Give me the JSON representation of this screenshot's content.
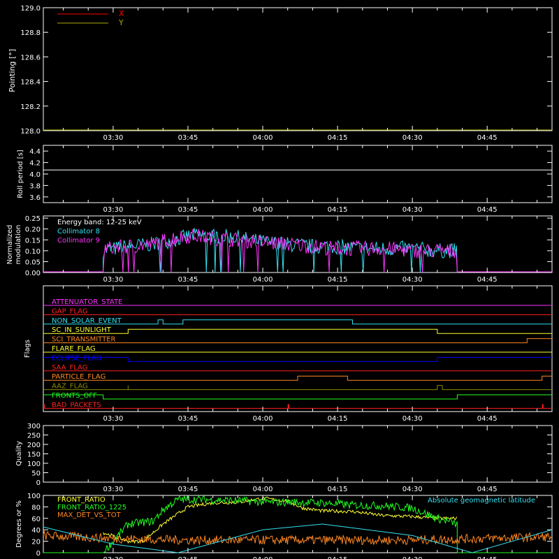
{
  "time_labels": [
    "03:30",
    "03:45",
    "04:00",
    "04:15",
    "04:30",
    "04:45"
  ],
  "colors": {
    "background": "#000000",
    "axes": "#ffffff",
    "x_red": "#ff0000",
    "y_olive": "#aaaa00",
    "cyan": "#33e0f0",
    "magenta": "#ff33ff",
    "green": "#22ff22",
    "yellow": "#ffff33",
    "orange": "#ff8822",
    "blue": "#0000ff",
    "olive": "#888800"
  },
  "panels": {
    "pointing": {
      "ylabel": "Pointing [°]",
      "ytick_labels": [
        "128.0",
        "128.2",
        "128.4",
        "128.6",
        "128.8",
        "129.0"
      ],
      "legend": [
        "X",
        "Y"
      ]
    },
    "roll": {
      "ylabel": "Roll period [s]",
      "ytick_labels": [
        "3.6",
        "3.8",
        "4.0",
        "4.2",
        "4.4"
      ]
    },
    "modulation": {
      "ylabel_line1": "Normalized",
      "ylabel_line2": "modulation",
      "ytick_labels": [
        "0.00",
        "0.05",
        "0.10",
        "0.15",
        "0.20",
        "0.25"
      ],
      "annotation": "Energy band: 12-25 keV",
      "legend": [
        "Collimator 8",
        "Collimator 9"
      ]
    },
    "flags": {
      "ylabel": "Flags",
      "labels": [
        "ATTENUATOR_STATE",
        "GAP_FLAG",
        "NON_SOLAR_EVENT",
        "SC_IN_SUNLIGHT",
        "SCI_TRANSMITTER",
        "FLARE_FLAG",
        "ECLIPSE_FLAG",
        "SAA_FLAG",
        "PARTICLE_FLAG",
        "AAZ_FLAG",
        "FRONTS_OFF",
        "BAD_PACKETS"
      ]
    },
    "quality": {
      "ylabel": "Quality",
      "ytick_labels": [
        "0",
        "50",
        "100",
        "150",
        "200",
        "250",
        "300"
      ]
    },
    "ratios": {
      "ylabel": "Degrees or %",
      "ytick_labels": [
        "0",
        "20",
        "40",
        "60",
        "80",
        "100"
      ],
      "legend": [
        "FRONT_RATIO",
        "FRONT_RATIO_1225",
        "MAX_DET_VS_TOT"
      ],
      "legend_right": "Absolute geomagnetic latitude"
    }
  },
  "chart_data": [
    {
      "type": "line",
      "panel": "pointing",
      "x_range": [
        "03:16",
        "04:58"
      ],
      "ylim": [
        128.0,
        129.0
      ],
      "series": [
        {
          "name": "X",
          "color": "#ff0000",
          "x": [
            "03:16",
            "04:58"
          ],
          "y": [
            128.0,
            128.0
          ]
        },
        {
          "name": "Y",
          "color": "#aaaa00",
          "x": [
            "03:16",
            "04:58"
          ],
          "y": [
            128.0,
            128.0
          ]
        }
      ]
    },
    {
      "type": "line",
      "panel": "roll",
      "x_range": [
        "03:16",
        "04:58"
      ],
      "ylim": [
        3.5,
        4.5
      ],
      "series": [
        {
          "x": [
            "03:16",
            "04:58"
          ],
          "y": [
            4.07,
            4.07
          ]
        }
      ]
    },
    {
      "type": "line",
      "panel": "modulation",
      "x_range": [
        "03:16",
        "04:58"
      ],
      "ylim": [
        0.0,
        0.26
      ],
      "series": [
        {
          "name": "Collimator 8",
          "color": "#33e0f0",
          "x": [
            "03:28",
            "03:33",
            "03:38",
            "03:42",
            "03:46",
            "03:50",
            "03:55",
            "04:00",
            "04:05",
            "04:10",
            "04:15",
            "04:20",
            "04:25",
            "04:30",
            "04:35",
            "04:39"
          ],
          "y": [
            0.1,
            0.12,
            0.13,
            0.15,
            0.17,
            0.17,
            0.16,
            0.14,
            0.13,
            0.12,
            0.12,
            0.11,
            0.11,
            0.11,
            0.1,
            0.1
          ]
        },
        {
          "name": "Collimator 9",
          "color": "#ff33ff",
          "x": [
            "03:28",
            "03:33",
            "03:38",
            "03:42",
            "03:46",
            "03:50",
            "03:55",
            "04:00",
            "04:05",
            "04:10",
            "04:15",
            "04:20",
            "04:25",
            "04:30",
            "04:35",
            "04:39"
          ],
          "y": [
            0.11,
            0.12,
            0.13,
            0.16,
            0.17,
            0.16,
            0.15,
            0.14,
            0.13,
            0.12,
            0.11,
            0.11,
            0.11,
            0.1,
            0.1,
            0.1
          ]
        }
      ]
    },
    {
      "type": "line",
      "panel": "flags",
      "x_range": [
        "03:16",
        "04:58"
      ],
      "series": [
        {
          "name": "ATTENUATOR_STATE",
          "color": "#ff33ff",
          "levels": [
            [
              "03:16",
              0
            ]
          ]
        },
        {
          "name": "GAP_FLAG",
          "color": "#ff2222",
          "levels": [
            [
              "03:16",
              0
            ]
          ]
        },
        {
          "name": "NON_SOLAR_EVENT",
          "color": "#33e0f0",
          "levels": [
            [
              "03:16",
              0
            ],
            [
              "03:39",
              1
            ],
            [
              "03:40",
              0
            ],
            [
              "03:44",
              1
            ],
            [
              "04:18",
              0
            ]
          ]
        },
        {
          "name": "SC_IN_SUNLIGHT",
          "color": "#ffff33",
          "levels": [
            [
              "03:16",
              0
            ],
            [
              "03:33",
              1
            ],
            [
              "04:35",
              0
            ]
          ]
        },
        {
          "name": "SCI_TRANSMITTER",
          "color": "#ff8822",
          "levels": [
            [
              "03:16",
              0
            ],
            [
              "04:53",
              1
            ]
          ]
        },
        {
          "name": "FLARE_FLAG",
          "color": "#ffff33",
          "levels": [
            [
              "03:16",
              0
            ]
          ]
        },
        {
          "name": "ECLIPSE_FLAG",
          "color": "#0000ff",
          "levels": [
            [
              "03:16",
              1
            ],
            [
              "03:33",
              0
            ],
            [
              "04:35",
              1
            ]
          ]
        },
        {
          "name": "SAA_FLAG",
          "color": "#ff2222",
          "levels": [
            [
              "03:16",
              0
            ]
          ]
        },
        {
          "name": "PARTICLE_FLAG",
          "color": "#ff8822",
          "levels": [
            [
              "03:16",
              0
            ],
            [
              "04:07",
              1
            ],
            [
              "04:17",
              0
            ],
            [
              "04:56",
              1
            ]
          ]
        },
        {
          "name": "AAZ_FLAG",
          "color": "#888800",
          "levels": [
            [
              "03:16",
              0
            ],
            [
              "03:33",
              1
            ],
            [
              "03:33",
              0
            ],
            [
              "04:35",
              1
            ],
            [
              "04:36",
              0
            ]
          ]
        },
        {
          "name": "FRONTS_OFF",
          "color": "#22ff22",
          "levels": [
            [
              "03:16",
              1
            ],
            [
              "03:28",
              0
            ],
            [
              "04:39",
              1
            ]
          ]
        },
        {
          "name": "BAD_PACKETS",
          "color": "#ff2222",
          "spikes": [
            "03:16",
            "04:05",
            "04:56"
          ]
        }
      ]
    },
    {
      "type": "line",
      "panel": "quality",
      "x_range": [
        "03:16",
        "04:58"
      ],
      "ylim": [
        0,
        300
      ],
      "series": []
    },
    {
      "type": "line",
      "panel": "ratios",
      "x_range": [
        "03:16",
        "04:58"
      ],
      "ylim": [
        0,
        100
      ],
      "series": [
        {
          "name": "FRONT_RATIO",
          "color": "#ffff33",
          "x": [
            "03:28",
            "03:33",
            "03:36",
            "03:40",
            "03:45",
            "03:50",
            "03:55",
            "04:00",
            "04:05",
            "04:08",
            "04:12",
            "04:18",
            "04:24",
            "04:30",
            "04:35",
            "04:39"
          ],
          "y": [
            35,
            20,
            20,
            50,
            80,
            87,
            88,
            95,
            90,
            78,
            73,
            72,
            65,
            63,
            60,
            60
          ]
        },
        {
          "name": "FRONT_RATIO_1225",
          "color": "#22ff22",
          "x": [
            "03:16",
            "03:28",
            "03:33",
            "03:38",
            "03:40",
            "03:43",
            "03:47",
            "03:52",
            "03:57",
            "04:02",
            "04:07",
            "04:12",
            "04:18",
            "04:24",
            "04:30",
            "04:35",
            "04:39"
          ],
          "y": [
            0,
            0,
            50,
            55,
            75,
            93,
            93,
            92,
            90,
            88,
            88,
            87,
            83,
            82,
            78,
            60,
            50
          ]
        },
        {
          "name": "MAX_DET_VS_TOT",
          "color": "#ff8822",
          "x": [
            "03:16",
            "03:30",
            "03:45",
            "04:00",
            "04:15",
            "04:30",
            "04:45",
            "04:58"
          ],
          "y": [
            30,
            25,
            22,
            22,
            22,
            22,
            25,
            28
          ]
        },
        {
          "name": "Absolute geomagnetic latitude",
          "color": "#33e0f0",
          "x": [
            "03:16",
            "03:30",
            "03:43",
            "04:00",
            "04:12",
            "04:30",
            "04:42",
            "04:58"
          ],
          "y": [
            45,
            15,
            0,
            40,
            50,
            30,
            0,
            40
          ]
        }
      ]
    }
  ]
}
